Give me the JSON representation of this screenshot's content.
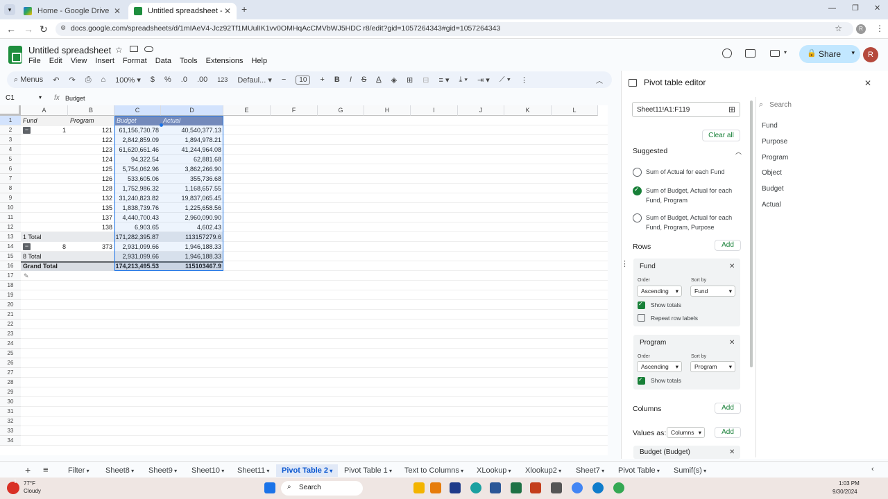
{
  "browser": {
    "tabs": [
      {
        "title": "Home - Google Drive",
        "active": false
      },
      {
        "title": "Untitled spreadsheet - Google",
        "active": true
      }
    ],
    "url": "docs.google.com/spreadsheets/d/1mIAeV4-Jcz92Tf1MUulIK1vv0OMHqAcCMVbWJ5HDC r8/edit?gid=1057264343#gid=1057264343"
  },
  "doc": {
    "title": "Untitled spreadsheet",
    "menu": [
      "File",
      "Edit",
      "View",
      "Insert",
      "Format",
      "Data",
      "Tools",
      "Extensions",
      "Help"
    ],
    "share_label": "Share",
    "avatar_letter": "R"
  },
  "toolbar": {
    "menus_label": "Menus",
    "zoom": "100%",
    "currency": "$",
    "percent": "%",
    "dec_less": ".0",
    "dec_more": ".00",
    "format_123": "123",
    "font": "Defaul...",
    "font_size": "10",
    "minus": "−",
    "plus": "+",
    "bold": "B",
    "italic": "I",
    "strike": "S",
    "text_color": "A"
  },
  "formula_bar": {
    "name_box": "C1",
    "fx": "fx",
    "content": "Budget"
  },
  "grid": {
    "columns": [
      "A",
      "B",
      "C",
      "D",
      "E",
      "F",
      "G",
      "H",
      "I",
      "J",
      "K",
      "L"
    ],
    "row_numbers": [
      "1",
      "2",
      "3",
      "4",
      "5",
      "6",
      "7",
      "8",
      "9",
      "10",
      "11",
      "12",
      "13",
      "14",
      "15",
      "16",
      "17",
      "18",
      "19",
      "20",
      "21",
      "22",
      "23",
      "24",
      "25",
      "26",
      "27",
      "28",
      "29",
      "30",
      "31",
      "32",
      "33",
      "34"
    ],
    "headers": [
      "Fund",
      "Program",
      "Budget",
      "Actual"
    ],
    "rows": [
      {
        "fund": "1",
        "program": "121",
        "budget": "61,156,730.78",
        "actual": "40,540,377.13"
      },
      {
        "fund": "",
        "program": "122",
        "budget": "2,842,859.09",
        "actual": "1,894,978.21"
      },
      {
        "fund": "",
        "program": "123",
        "budget": "61,620,661.46",
        "actual": "41,244,964.08"
      },
      {
        "fund": "",
        "program": "124",
        "budget": "94,322.54",
        "actual": "62,881.68"
      },
      {
        "fund": "",
        "program": "125",
        "budget": "5,754,062.96",
        "actual": "3,862,266.90"
      },
      {
        "fund": "",
        "program": "126",
        "budget": "533,605.06",
        "actual": "355,736.68"
      },
      {
        "fund": "",
        "program": "128",
        "budget": "1,752,986.32",
        "actual": "1,168,657.55"
      },
      {
        "fund": "",
        "program": "132",
        "budget": "31,240,823.82",
        "actual": "19,837,065.45"
      },
      {
        "fund": "",
        "program": "135",
        "budget": "1,838,739.76",
        "actual": "1,225,658.56"
      },
      {
        "fund": "",
        "program": "137",
        "budget": "4,440,700.43",
        "actual": "2,960,090.90"
      },
      {
        "fund": "",
        "program": "138",
        "budget": "6,903.65",
        "actual": "4,602.43"
      }
    ],
    "total1": {
      "label": "1 Total",
      "budget": "171,282,395.87",
      "actual": "113157279.6"
    },
    "row8": {
      "fund": "8",
      "program": "373",
      "budget": "2,931,099.66",
      "actual": "1,946,188.33"
    },
    "total8": {
      "label": "8 Total",
      "budget": "2,931,099.66",
      "actual": "1,946,188.33"
    },
    "grand": {
      "label": "Grand Total",
      "budget": "174,213,495.53",
      "actual": "115103467.9"
    }
  },
  "sheet_tabs": [
    "Filter",
    "Sheet8",
    "Sheet9",
    "Sheet10",
    "Sheet11",
    "Pivot Table 2",
    "Pivot Table 1",
    "Text to Columns",
    "XLookup",
    "Xlookup2",
    "Sheet7",
    "Pivot Table",
    "Sumif(s)"
  ],
  "active_sheet": "Pivot Table 2",
  "pivot_editor": {
    "title": "Pivot table editor",
    "range": "Sheet11!A1:F119",
    "clear_all": "Clear all",
    "suggested_label": "Suggested",
    "suggestions": [
      {
        "text": "Sum of Actual for each Fund",
        "selected": false
      },
      {
        "text": "Sum of Budget, Actual for each Fund, Program",
        "selected": true
      },
      {
        "text": "Sum of Budget, Actual for each Fund, Program, Purpose",
        "selected": false
      }
    ],
    "rows_label": "Rows",
    "add_label": "Add",
    "order_label": "Order",
    "sort_by_label": "Sort by",
    "row_cards": [
      {
        "name": "Fund",
        "order": "Ascending",
        "sort_by": "Fund",
        "show_totals": "Show totals",
        "repeat_labels": "Repeat row labels"
      },
      {
        "name": "Program",
        "order": "Ascending",
        "sort_by": "Program",
        "show_totals": "Show totals"
      }
    ],
    "columns_label": "Columns",
    "values_as_label": "Values as:",
    "values_as_value": "Columns",
    "value_card": "Budget (Budget)",
    "search_placeholder": "Search",
    "fields": [
      "Fund",
      "Purpose",
      "Program",
      "Object",
      "Budget",
      "Actual"
    ]
  },
  "taskbar": {
    "weather_temp": "77°F",
    "weather_desc": "Cloudy",
    "search": "Search",
    "time": "1:03 PM",
    "date": "9/30/2024",
    "badge": "1"
  },
  "colors": {
    "accent_green": "#188038",
    "selection_blue": "#1a73e8",
    "share_bg": "#c2e7ff"
  }
}
